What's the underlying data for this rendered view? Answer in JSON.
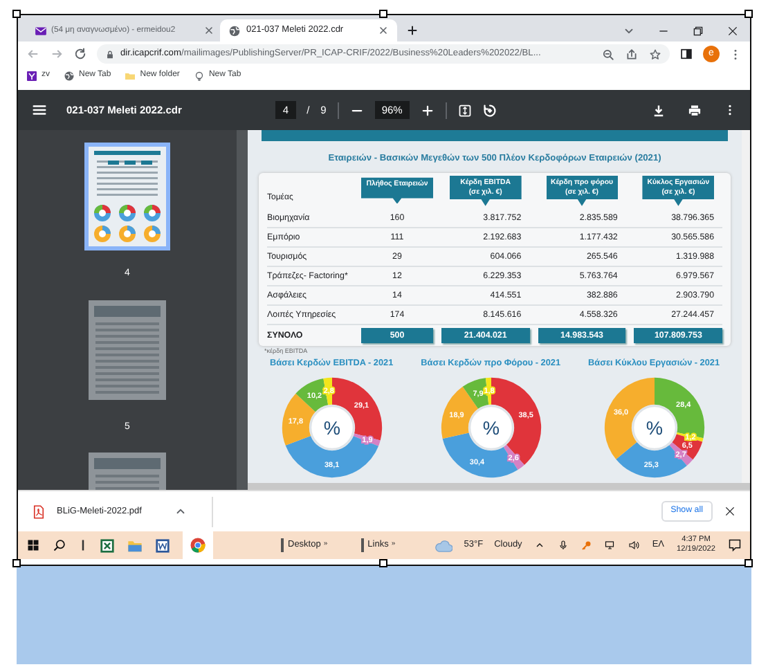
{
  "tabs": [
    {
      "kind": "mail",
      "title": "(54 μη αναγνωσμένο) - ermeidou2",
      "selected": false
    },
    {
      "kind": "web",
      "title": "021-037 Meleti 2022.cdr",
      "selected": true
    }
  ],
  "address": {
    "domain": "dir.icapcrif.com",
    "path": "/mailimages/PublishingServer/PR_ICAP-CRIF/2022/Business%20Leaders%202022/BL..."
  },
  "avatar": "e",
  "bookmarks": [
    {
      "kind": "app",
      "label": "zv"
    },
    {
      "kind": "globe",
      "label": "New Tab"
    },
    {
      "kind": "folder",
      "label": "New folder"
    },
    {
      "kind": "bulb",
      "label": "New Tab"
    }
  ],
  "pdf_toolbar": {
    "title": "021-037 Meleti 2022.cdr",
    "page": "4",
    "separator": "/",
    "total": "9",
    "zoom": "96%"
  },
  "thumbnails": [
    {
      "label": "4",
      "selected": true
    },
    {
      "label": "5",
      "selected": false
    },
    {
      "selected": false
    }
  ],
  "document": {
    "subtitle": "Εταιρειών - Βασικών Μεγεθών των 500 Πλέον Κερδοφόρων Εταιρειών  (2021)",
    "sector_header": "Τομέας",
    "columns": [
      {
        "title": "Πλήθος Εταιρειών"
      },
      {
        "title": "Κέρδη EBITDA",
        "unit": "(σε χιλ. €)"
      },
      {
        "title": "Κέρδη προ φόρου",
        "unit": "(σε χιλ. €)"
      },
      {
        "title": "Κύκλος Εργασιών",
        "unit": "(σε χιλ. €)"
      }
    ],
    "rows": [
      {
        "sector": "Βιομηχανία",
        "values": [
          "160",
          "3.817.752",
          "2.835.589",
          "38.796.365"
        ]
      },
      {
        "sector": "Εμπόριο",
        "values": [
          "111",
          "2.192.683",
          "1.177.432",
          "30.565.586"
        ]
      },
      {
        "sector": "Τουρισμός",
        "values": [
          "29",
          "604.066",
          "265.546",
          "1.319.988"
        ]
      },
      {
        "sector": "Τράπεζες- Factoring*",
        "values": [
          "12",
          "6.229.353",
          "5.763.764",
          "6.979.567"
        ]
      },
      {
        "sector": "Ασφάλειες",
        "values": [
          "14",
          "414.551",
          "382.886",
          "2.903.790"
        ]
      },
      {
        "sector": "Λοιπές Υπηρεσίες",
        "values": [
          "174",
          "8.145.616",
          "4.558.326",
          "27.244.457"
        ]
      }
    ],
    "total": {
      "label": "ΣΥΝΟΛΟ",
      "values": [
        "500",
        "21.404.021",
        "14.983.543",
        "107.809.753"
      ]
    },
    "footnote": "*κέρδη EBITDA",
    "charts": [
      {
        "center_label": "%",
        "chart_data": {
          "type": "donut",
          "title": "Βάσει Κερδών EBITDA - 2021",
          "values": [
            29.1,
            1.9,
            38.1,
            17.8,
            10.2,
            2.8
          ],
          "colors": [
            "#e0343b",
            "#d581c4",
            "#4a9fdc",
            "#f6ae2d",
            "#67ba3c",
            "#f3e51b"
          ],
          "value_labels": [
            "29,1",
            "1,9",
            "38,1",
            "17,8",
            "10,2",
            "2,8"
          ]
        }
      },
      {
        "center_label": "%",
        "chart_data": {
          "type": "donut",
          "title": "Βάσει Κερδών προ Φόρου - 2021",
          "values": [
            38.5,
            2.6,
            30.4,
            18.9,
            7.9,
            1.8
          ],
          "colors": [
            "#e0343b",
            "#d581c4",
            "#4a9fdc",
            "#f6ae2d",
            "#67ba3c",
            "#f3e51b"
          ],
          "value_labels": [
            "38,5",
            "2,6",
            "30,4",
            "18,9",
            "7,9",
            "1,8"
          ]
        }
      },
      {
        "center_label": "%",
        "chart_data": {
          "type": "donut",
          "title": "Βάσει Κύκλου Εργασιών - 2021",
          "values": [
            28.4,
            1.2,
            6.5,
            2.7,
            25.3,
            36.0
          ],
          "colors": [
            "#67ba3c",
            "#f3e51b",
            "#e0343b",
            "#d581c4",
            "#4a9fdc",
            "#f6ae2d"
          ],
          "value_labels": [
            "28,4",
            "1,2",
            "6,5",
            "2,7",
            "25,3",
            "36,0"
          ]
        }
      }
    ]
  },
  "download": {
    "file": "BLiG-Meleti-2022.pdf",
    "show_all": "Show all"
  },
  "taskbar": {
    "toolbars": [
      {
        "label": "Desktop",
        "more": "»"
      },
      {
        "label": "Links",
        "more": "»"
      }
    ],
    "weather": {
      "temperature": "53°F",
      "condition": "Cloudy"
    },
    "language": "ΕΛ",
    "time": "4:37 PM",
    "date": "12/19/2022"
  }
}
